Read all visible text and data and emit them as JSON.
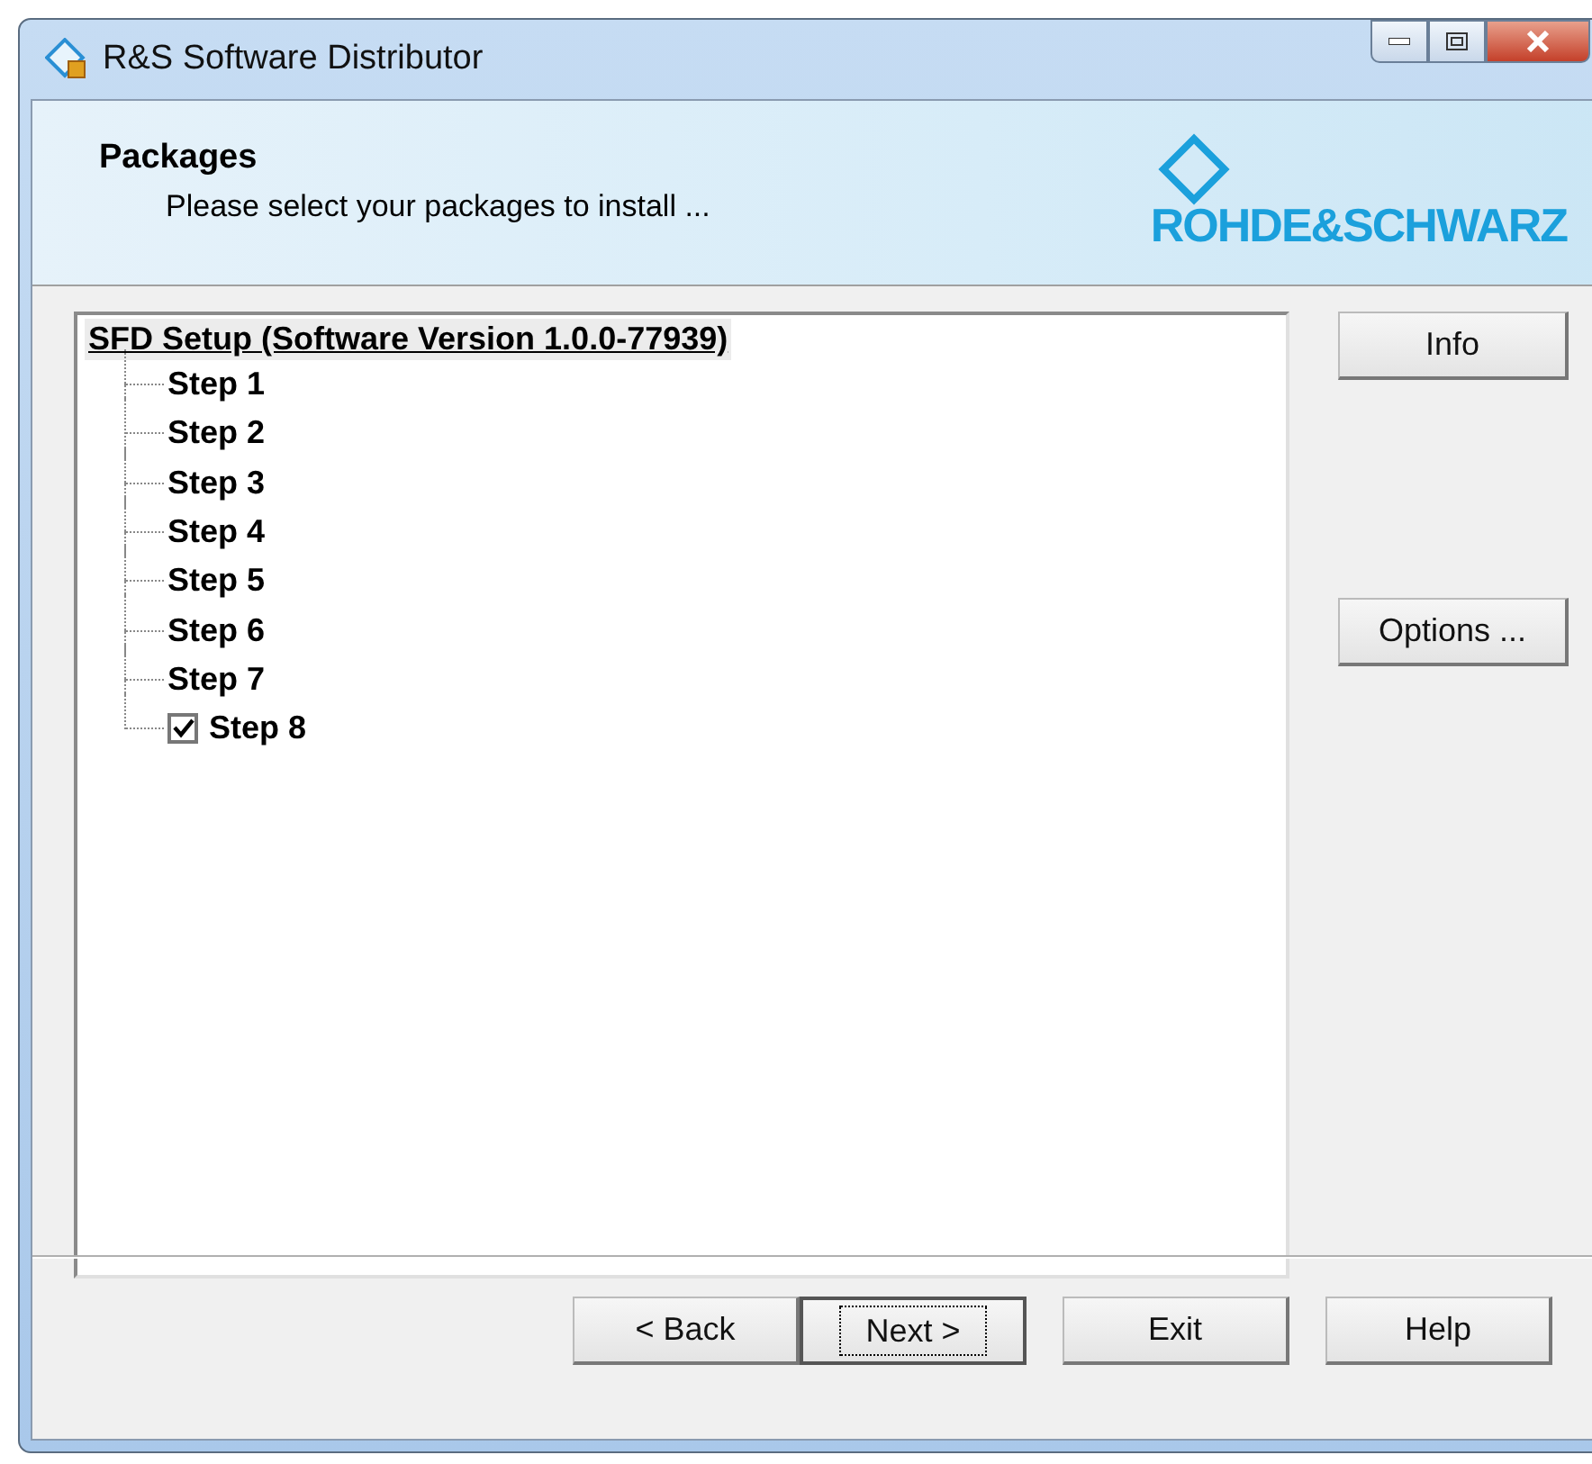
{
  "window": {
    "title": "R&S Software Distributor"
  },
  "header": {
    "title": "Packages",
    "subtitle": "Please select your packages to install ...",
    "logo_text": "ROHDE&SCHWARZ"
  },
  "tree": {
    "root": {
      "label": "SFD Setup (Software Version 1.0.0-77939)",
      "selected": true,
      "children": [
        {
          "label": "Step 1",
          "kind": "plain"
        },
        {
          "label": "Step 2",
          "kind": "plain"
        },
        {
          "label": "Step 3",
          "kind": "plain"
        },
        {
          "label": "Step 4",
          "kind": "plain"
        },
        {
          "label": "Step 5",
          "kind": "plain"
        },
        {
          "label": "Step 6",
          "kind": "plain"
        },
        {
          "label": "Step 7",
          "kind": "plain"
        },
        {
          "label": "Step 8",
          "kind": "checkbox",
          "checked": true
        }
      ]
    }
  },
  "side_buttons": [
    {
      "label": "Info"
    },
    {
      "label": "Options ..."
    }
  ],
  "buttons": [
    {
      "label": "< Back",
      "focused": false
    },
    {
      "label": "Next >",
      "focused": true
    },
    {
      "label": "Exit",
      "focused": false
    },
    {
      "label": "Help",
      "focused": false
    }
  ]
}
